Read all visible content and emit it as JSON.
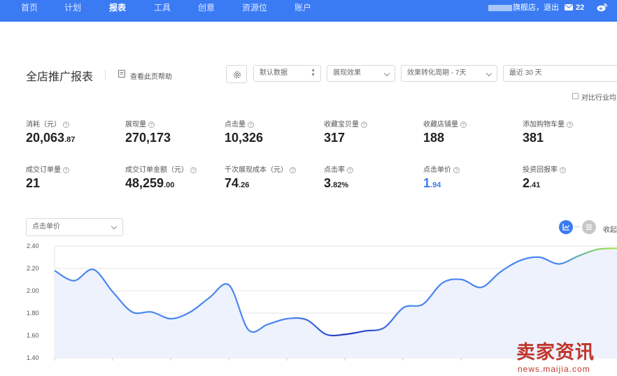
{
  "nav": {
    "items": [
      {
        "label": "首页",
        "active": false
      },
      {
        "label": "计划",
        "active": false
      },
      {
        "label": "报表",
        "active": true
      },
      {
        "label": "工具",
        "active": false
      },
      {
        "label": "创意",
        "active": false
      },
      {
        "label": "资源位",
        "active": false
      },
      {
        "label": "账户",
        "active": false
      }
    ],
    "store_suffix": "旗舰店，退出",
    "message_count": "22",
    "brand_color": "#3a7bf3"
  },
  "header": {
    "title": "全店推广报表",
    "help_label": "查看此页帮助"
  },
  "controls": {
    "data_select": "默认数据",
    "effect_select": "展现效果",
    "period_select": "效果转化周期 - 7天",
    "date_range": "最近 30 天",
    "compare_label": "对比行业均"
  },
  "metrics": [
    {
      "label": "消耗（元）",
      "int": "20,063",
      "dec": ".87"
    },
    {
      "label": "展现量",
      "int": "270,173",
      "dec": ""
    },
    {
      "label": "点击量",
      "int": "10,326",
      "dec": ""
    },
    {
      "label": "收藏宝贝量",
      "int": "317",
      "dec": ""
    },
    {
      "label": "收藏店铺量",
      "int": "188",
      "dec": ""
    },
    {
      "label": "添加购物车量",
      "int": "381",
      "dec": ""
    },
    {
      "label": "成交订单量",
      "int": "21",
      "dec": ""
    },
    {
      "label": "成交订单金额（元）",
      "int": "48,259",
      "dec": ".00"
    },
    {
      "label": "千次展现成本（元）",
      "int": "74",
      "dec": ".26"
    },
    {
      "label": "点击率",
      "int": "3",
      "dec": ".82%"
    },
    {
      "label": "点击单价",
      "int": "1",
      "dec": ".94",
      "highlight": true
    },
    {
      "label": "投资回报率",
      "int": "2",
      "dec": ".41"
    }
  ],
  "chart": {
    "metric_select": "点击单价",
    "collapse_label": "收起"
  },
  "chart_data": {
    "type": "area",
    "title": "",
    "xlabel": "",
    "ylabel": "",
    "ylim": [
      1.4,
      2.4
    ],
    "yticks": [
      "2.40",
      "2.20",
      "2.00",
      "1.80",
      "1.60",
      "1.40"
    ],
    "grid": true,
    "series": [
      {
        "values": [
          2.18,
          2.09,
          2.19,
          1.99,
          1.81,
          1.81,
          1.75,
          1.81,
          1.94,
          2.05,
          1.65,
          1.7,
          1.75,
          1.74,
          1.61,
          1.61,
          1.64,
          1.67,
          1.85,
          1.88,
          2.07,
          2.1,
          2.03,
          2.17,
          2.27,
          2.3,
          2.24,
          2.31,
          2.37,
          2.38
        ],
        "line_color": "#4a86f0",
        "fill_color": "#eef2fd"
      }
    ]
  },
  "watermark": {
    "title": "卖家资讯",
    "url": "news.maijia.com"
  }
}
